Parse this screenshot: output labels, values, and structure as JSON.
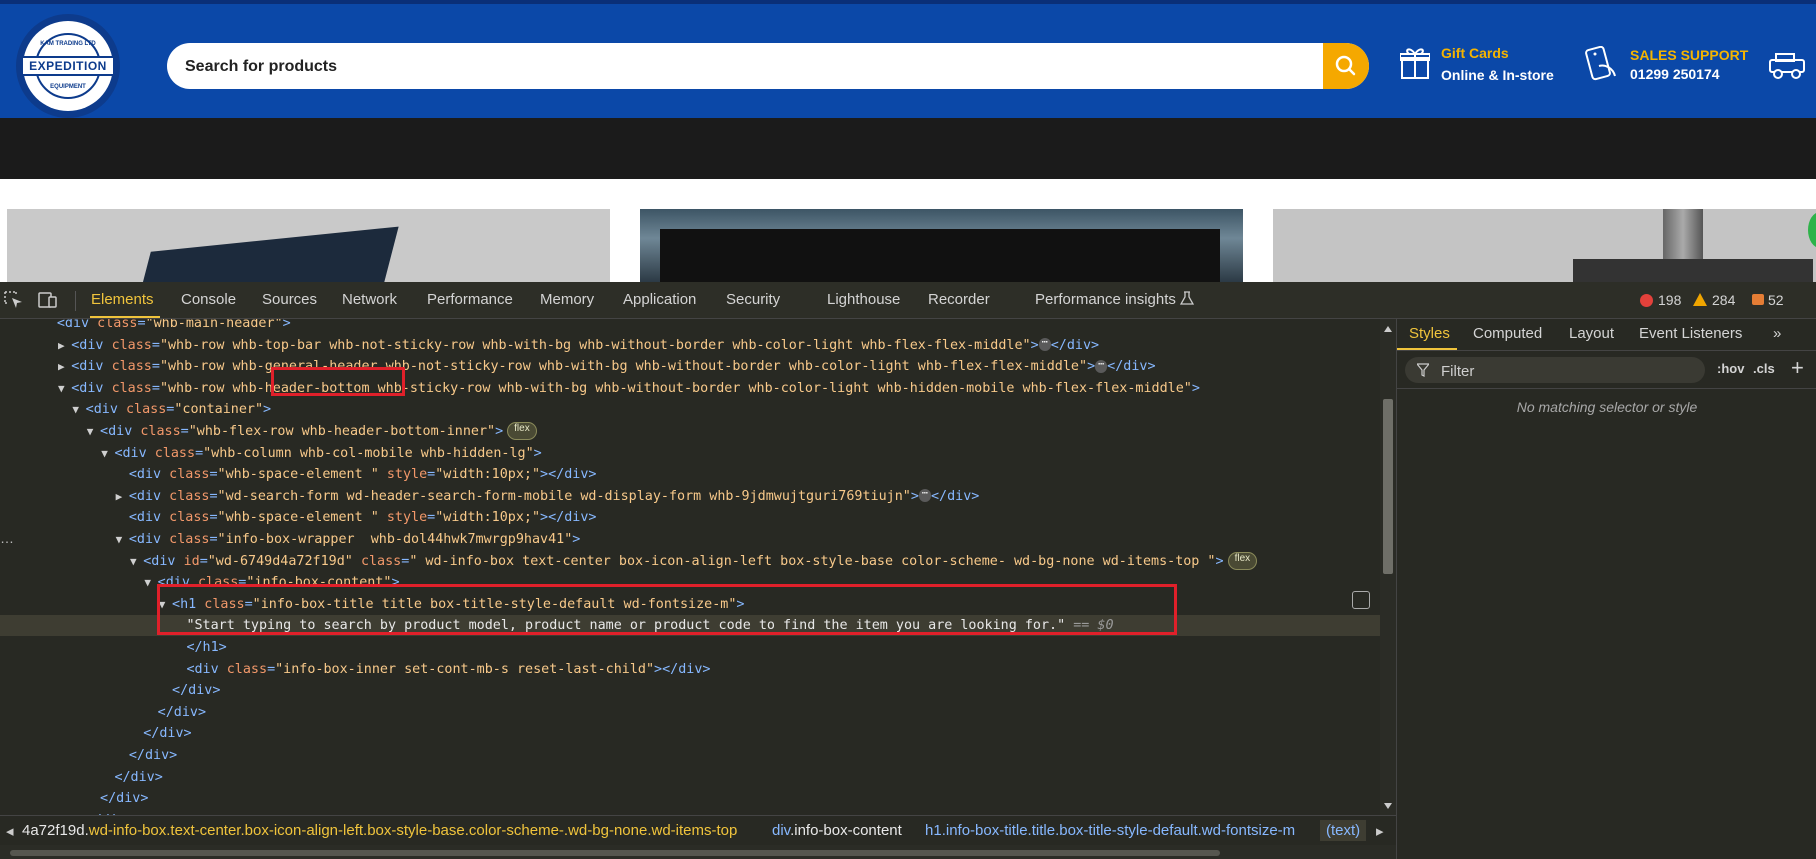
{
  "site": {
    "logo": {
      "name": "EXPEDITION",
      "top_text": "KAM TRADING LTD",
      "bottom_text": "EQUIPMENT"
    },
    "search": {
      "placeholder": "Search for products"
    },
    "gift": {
      "title": "Gift Cards",
      "subtitle": "Online & In-store"
    },
    "sales": {
      "title": "SALES SUPPORT",
      "phone": "01299 250174"
    }
  },
  "devtools": {
    "tabs": [
      "Elements",
      "Console",
      "Sources",
      "Network",
      "Performance",
      "Memory",
      "Application",
      "Security",
      "Lighthouse",
      "Recorder",
      "Performance insights"
    ],
    "active_tab": "Elements",
    "counts": {
      "errors": "198",
      "warnings": "284",
      "info": "52"
    },
    "elements": {
      "lines": [
        {
          "indent": 4,
          "open": "<div ",
          "attr": "class",
          "val": "\"whb-main-header\"",
          "close": ">"
        },
        {
          "indent": 5,
          "tri": "▶",
          "open": "<div ",
          "attr": "class",
          "val": "\"whb-row whb-top-bar whb-not-sticky-row whb-with-bg whb-without-border whb-color-light whb-flex-flex-middle\"",
          "close": ">",
          "dots": true,
          "end": "</div>"
        },
        {
          "indent": 5,
          "tri": "▶",
          "open": "<div ",
          "attr": "class",
          "val": "\"whb-row whb-general-header whb-not-sticky-row whb-with-bg whb-without-border whb-color-light whb-flex-flex-middle\"",
          "close": ">",
          "dots": true,
          "end": "</div>"
        },
        {
          "indent": 5,
          "tri": "▼",
          "open": "<div ",
          "attr": "class",
          "val": "\"whb-row whb-header-bottom whb-sticky-row whb-with-bg whb-without-border whb-color-light whb-hidden-mobile whb-flex-flex-middle\"",
          "close": ">"
        },
        {
          "indent": 6,
          "tri": "▼",
          "open": "<div ",
          "attr": "class",
          "val": "\"container\"",
          "close": ">"
        },
        {
          "indent": 7,
          "tri": "▼",
          "open": "<div ",
          "attr": "class",
          "val": "\"whb-flex-row whb-header-bottom-inner\"",
          "close": ">",
          "pill": "flex"
        },
        {
          "indent": 8,
          "tri": "▼",
          "open": "<div ",
          "attr": "class",
          "val": "\"whb-column whb-col-mobile whb-hidden-lg\"",
          "close": ">"
        },
        {
          "indent": 9,
          "open": "<div ",
          "attr": "class",
          "val": "\"whb-space-element \"",
          "attr2": "style",
          "val2": "\"width:10px;\"",
          "close": ">",
          "end": "</div>"
        },
        {
          "indent": 9,
          "tri": "▶",
          "open": "<div ",
          "attr": "class",
          "val": "\"wd-search-form wd-header-search-form-mobile wd-display-form whb-9jdmwujtguri769tiujn\"",
          "close": ">",
          "dots": true,
          "end": "</div>"
        },
        {
          "indent": 9,
          "open": "<div ",
          "attr": "class",
          "val": "\"whb-space-element \"",
          "attr2": "style",
          "val2": "\"width:10px;\"",
          "close": ">",
          "end": "</div>"
        },
        {
          "indent": 9,
          "tri": "▼",
          "open": "<div ",
          "attr": "class",
          "val": "\"info-box-wrapper  whb-dol44hwk7mwrgp9hav41\"",
          "close": ">"
        },
        {
          "indent": 10,
          "tri": "▼",
          "open": "<div ",
          "attr": "id",
          "val": "\"wd-6749d4a72f19d\"",
          "attr2": "class",
          "val2": "\" wd-info-box text-center box-icon-align-left box-style-base color-scheme- wd-bg-none wd-items-top \"",
          "close": ">",
          "pill": "flex"
        },
        {
          "indent": 11,
          "tri": "▼",
          "open": "<div ",
          "attr": "class",
          "val": "\"info-box-content\"",
          "close": ">"
        },
        {
          "indent": 12,
          "tri": "▼",
          "open": "<h1 ",
          "attr": "class",
          "val": "\"info-box-title title box-title-style-default wd-fontsize-m\"",
          "close": ">"
        },
        {
          "indent": 13,
          "text": "\"Start typing to search by product model, product name or product code to find the item you are looking for.\"",
          "eq": " == $0",
          "selected": true
        },
        {
          "indent": 13,
          "plain": "</h1>"
        },
        {
          "indent": 13,
          "open": "<div ",
          "attr": "class",
          "val": "\"info-box-inner set-cont-mb-s reset-last-child\"",
          "close": ">",
          "end": "</div>"
        },
        {
          "indent": 12,
          "plain": "</div>"
        },
        {
          "indent": 11,
          "plain": "</div>"
        },
        {
          "indent": 10,
          "plain": "</div>"
        },
        {
          "indent": 9,
          "plain": "</div>"
        },
        {
          "indent": 8,
          "plain": "</div>"
        },
        {
          "indent": 7,
          "plain": "</div>"
        },
        {
          "indent": 6,
          "plain": "</div>"
        }
      ]
    },
    "breadcrumbs": [
      {
        "tag": "",
        "cls": "4a72f19d.",
        "cls2": "wd-info-box.text-center.box-icon-align-left.box-style-base.color-scheme-.wd-bg-none.wd-items-top"
      },
      {
        "tag": "div",
        "cls": ".info-box-content"
      },
      {
        "tag": "h1",
        "cls": ".info-box-title.title.box-title-style-default.wd-fontsize-m"
      },
      {
        "tag": "(text)",
        "cls": ""
      }
    ],
    "styles": {
      "tabs": [
        "Styles",
        "Computed",
        "Layout",
        "Event Listeners"
      ],
      "more": "»",
      "filter_placeholder": "Filter",
      "hov": ":hov",
      "cls": ".cls",
      "plus": "+",
      "empty_message": "No matching selector or style"
    }
  }
}
